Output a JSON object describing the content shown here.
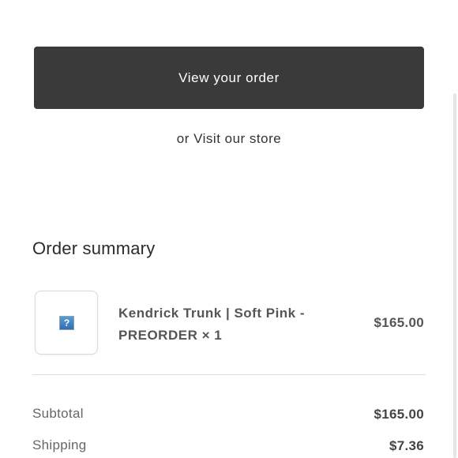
{
  "actions": {
    "view_order_label": "View your order",
    "visit_store_label": "or Visit our store"
  },
  "order_summary": {
    "title": "Order summary",
    "items": [
      {
        "name_line1": "Kendrick Trunk | Soft Pink -",
        "name_line2": "PREORDER × 1",
        "price": "$165.00",
        "image_icon": "broken-image-icon",
        "image_glyph": "?"
      }
    ],
    "subtotal_label": "Subtotal",
    "subtotal_value": "$165.00",
    "shipping_label": "Shipping",
    "shipping_value": "$7.36"
  },
  "colors": {
    "button_bg": "#3a3a3a",
    "button_text": "#ffffff",
    "text_primary": "#333333",
    "text_muted": "#666666"
  }
}
